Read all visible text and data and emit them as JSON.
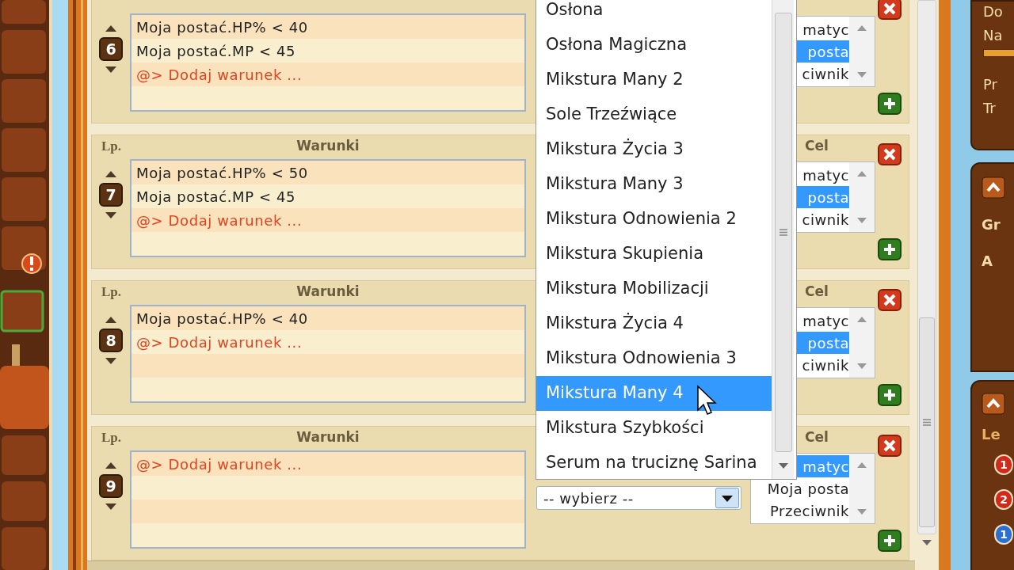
{
  "rules": [
    {
      "number": "6",
      "conditions": [
        {
          "kind": "condition",
          "text": "Moja postać.HP% < 40"
        },
        {
          "kind": "condition",
          "text": "Moja postać.MP < 45"
        },
        {
          "kind": "add",
          "text": "@> Dodaj warunek ..."
        }
      ],
      "target_options": [
        {
          "text": "matyc",
          "selected": false
        },
        {
          "text": "posta",
          "selected": true
        },
        {
          "text": "ciwnik",
          "selected": false
        }
      ]
    },
    {
      "number": "7",
      "lp_header": "Lp.",
      "conditions_header": "Warunki",
      "target_header": "Cel",
      "conditions": [
        {
          "kind": "condition",
          "text": "Moja postać.HP% < 50"
        },
        {
          "kind": "condition",
          "text": "Moja postać.MP < 45"
        },
        {
          "kind": "add",
          "text": "@> Dodaj warunek ..."
        }
      ],
      "target_options": [
        {
          "text": "matyc",
          "selected": false
        },
        {
          "text": "posta",
          "selected": true
        },
        {
          "text": "ciwnik",
          "selected": false
        }
      ]
    },
    {
      "number": "8",
      "lp_header": "Lp.",
      "conditions_header": "Warunki",
      "target_header": "Cel",
      "conditions": [
        {
          "kind": "condition",
          "text": "Moja postać.HP% < 40"
        },
        {
          "kind": "add",
          "text": "@> Dodaj warunek ..."
        }
      ],
      "target_options": [
        {
          "text": "matyc",
          "selected": false
        },
        {
          "text": "posta",
          "selected": true
        },
        {
          "text": "ciwnik",
          "selected": false
        }
      ]
    },
    {
      "number": "9",
      "lp_header": "Lp.",
      "conditions_header": "Warunki",
      "target_header": "Cel",
      "conditions": [
        {
          "kind": "add",
          "text": "@> Dodaj warunek ..."
        }
      ],
      "action_select": {
        "value": "-- wybierz --"
      },
      "target_options": [
        {
          "text": "matyc",
          "selected": true
        },
        {
          "text": "Moja posta",
          "selected": false
        },
        {
          "text": "Przeciwnik",
          "selected": false
        }
      ]
    }
  ],
  "dropdown": {
    "options": [
      {
        "text": "Osłona",
        "selected": false
      },
      {
        "text": "Osłona Magiczna",
        "selected": false
      },
      {
        "text": "Mikstura Many 2",
        "selected": false
      },
      {
        "text": "Sole Trzeźwiące",
        "selected": false
      },
      {
        "text": "Mikstura Życia 3",
        "selected": false
      },
      {
        "text": "Mikstura Many 3",
        "selected": false
      },
      {
        "text": "Mikstura Odnowienia 2",
        "selected": false
      },
      {
        "text": "Mikstura Skupienia",
        "selected": false
      },
      {
        "text": "Mikstura Mobilizacji",
        "selected": false
      },
      {
        "text": "Mikstura Życia 4",
        "selected": false
      },
      {
        "text": "Mikstura Odnowienia 3",
        "selected": false
      },
      {
        "text": "Mikstura Many 4",
        "selected": true
      },
      {
        "text": "Mikstura Szybkości",
        "selected": false
      },
      {
        "text": "Serum na truciznę Sarina",
        "selected": false
      }
    ]
  },
  "side_panel": {
    "top_labels": [
      "Do",
      "Na",
      "Pr",
      "Tr"
    ],
    "middle_labels": [
      "Gr",
      "A"
    ],
    "bottom_label": "Le",
    "potions": [
      "1",
      "2",
      "1"
    ]
  }
}
